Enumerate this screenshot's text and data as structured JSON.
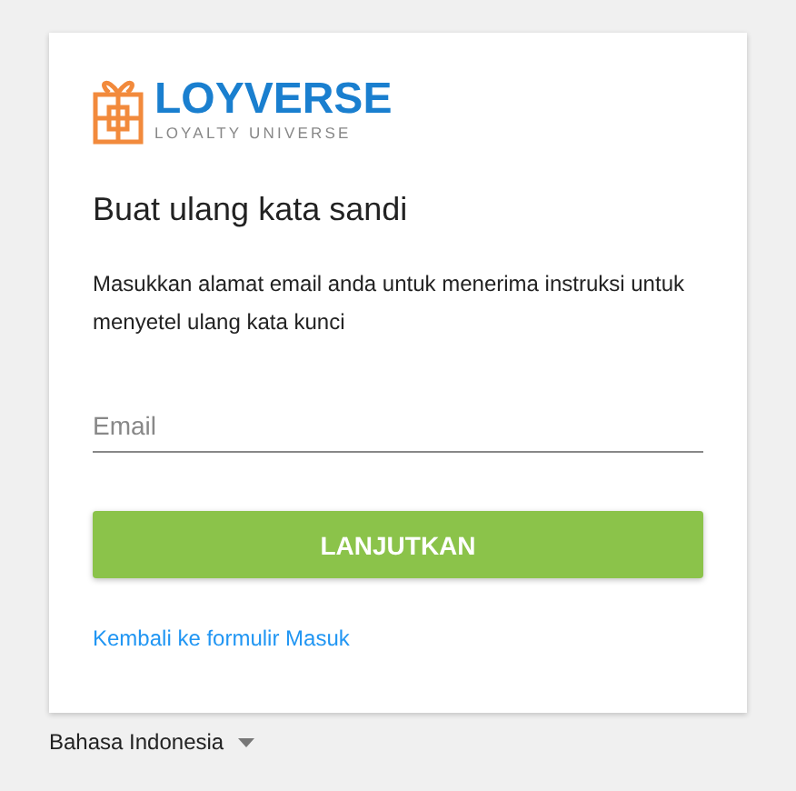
{
  "logo": {
    "name": "LOYVERSE",
    "tagline": "LOYALTY UNIVERSE"
  },
  "title": "Buat ulang kata sandi",
  "description": "Masukkan alamat email anda untuk menerima instruksi untuk menyetel ulang kata kunci",
  "email_field": {
    "placeholder": "Email"
  },
  "submit_button": "LANJUTKAN",
  "back_link": "Kembali ke formulir Masuk",
  "language": "Bahasa Indonesia"
}
